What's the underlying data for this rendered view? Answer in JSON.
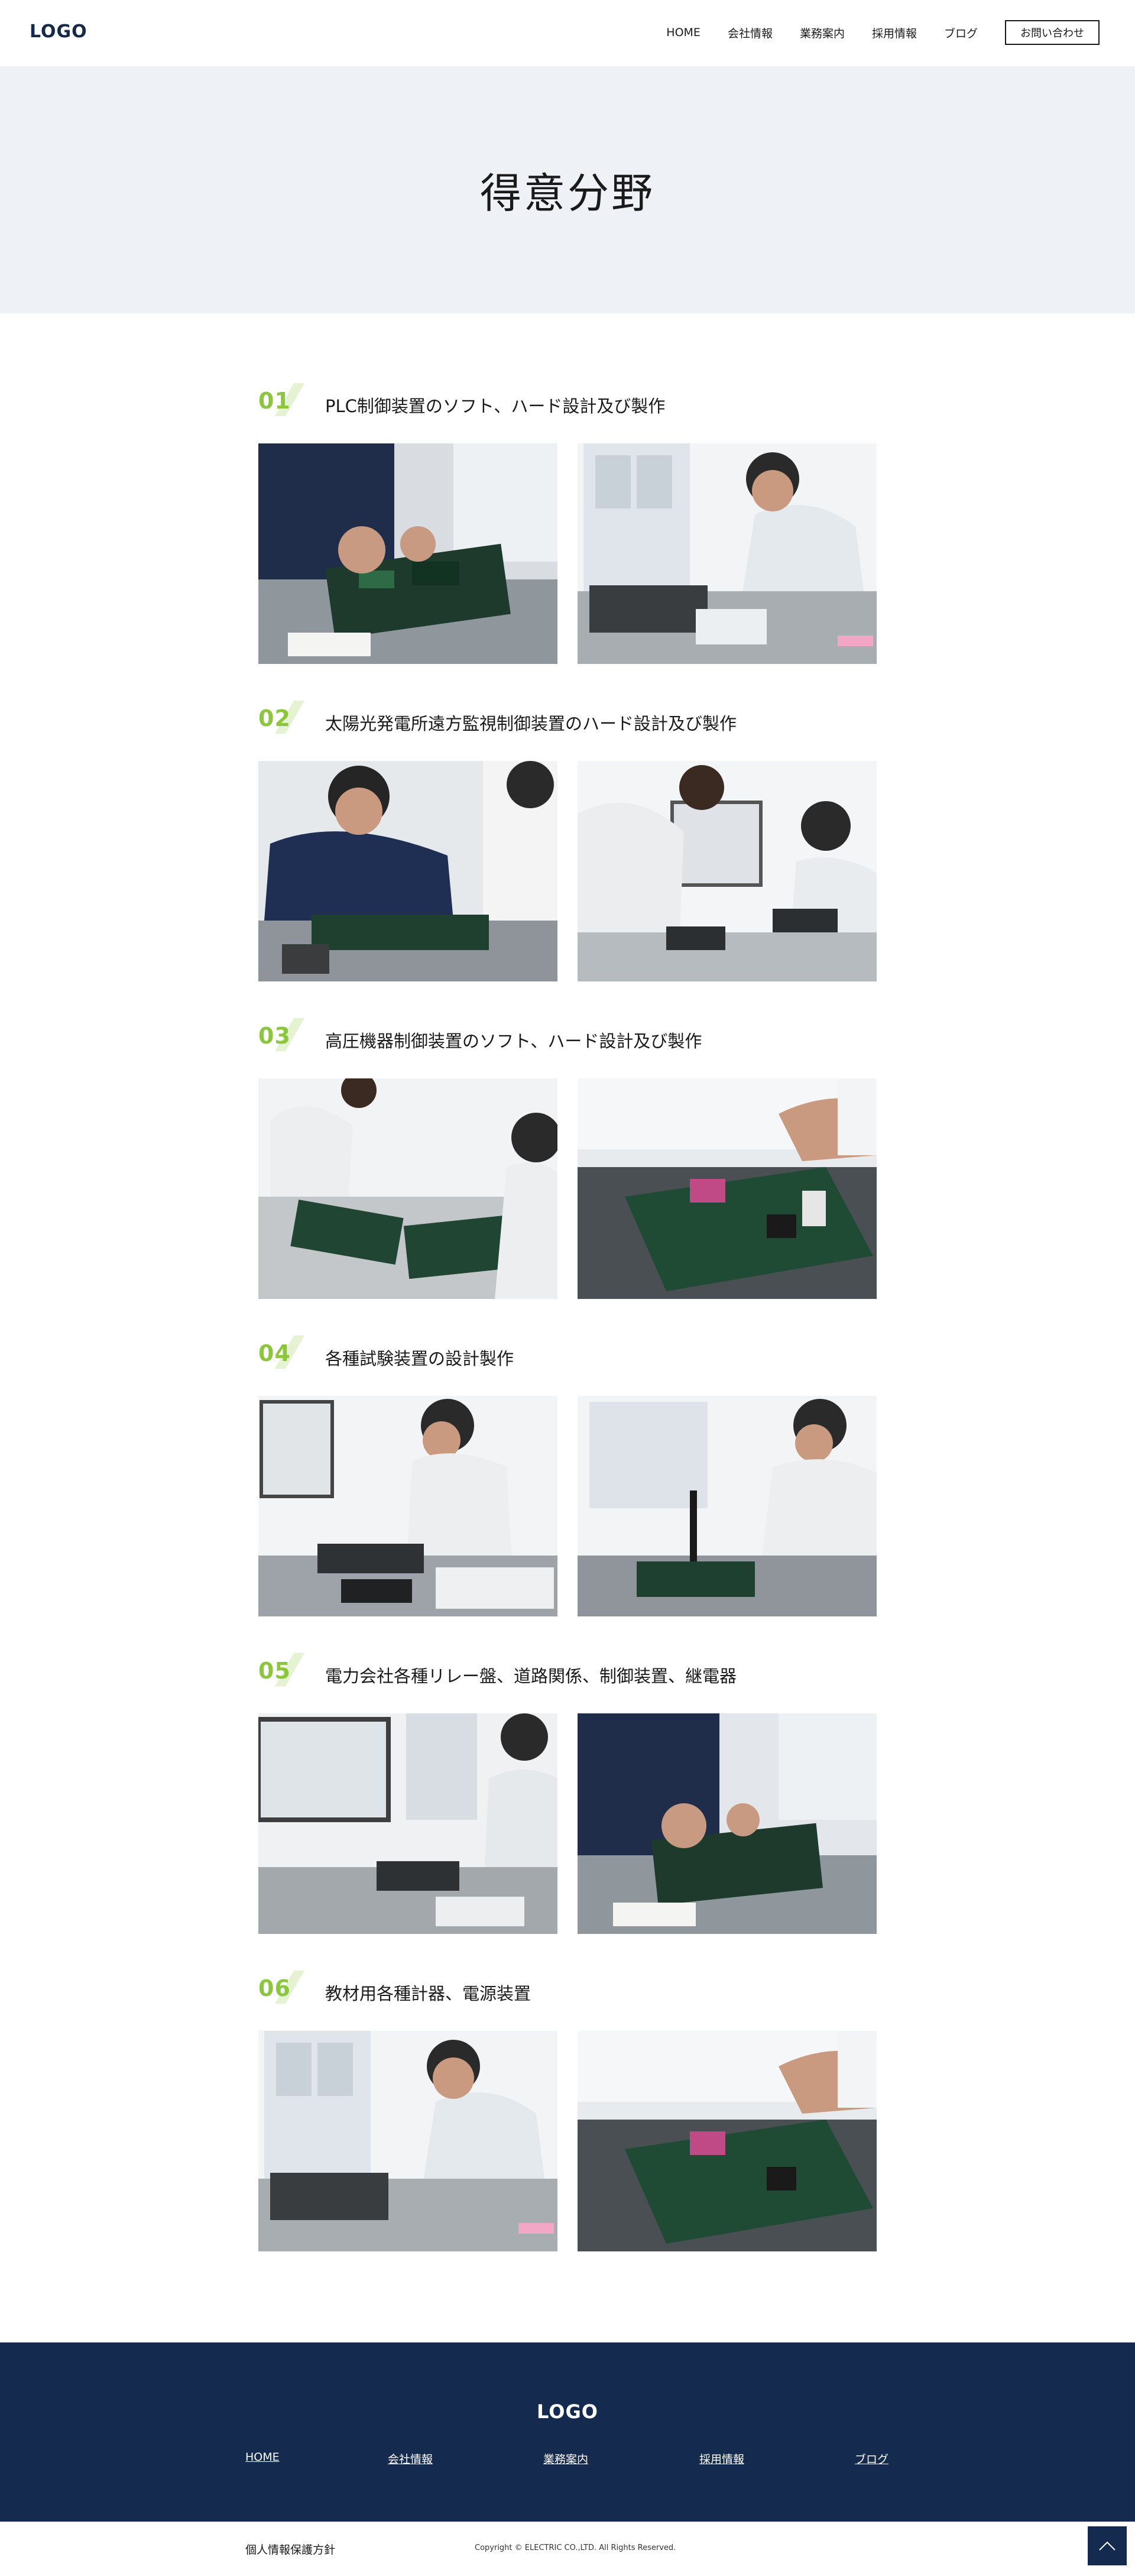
{
  "header": {
    "logo": "LOGO",
    "nav": [
      "HOME",
      "会社情報",
      "業務案内",
      "採用情報",
      "ブログ"
    ],
    "contact_label": "お問い合わせ"
  },
  "hero": {
    "title": "得意分野"
  },
  "sections": [
    {
      "num": "01",
      "title": "PLC制御装置のソフト、ハード設計及び製作"
    },
    {
      "num": "02",
      "title": "太陽光発電所遠方監視制御装置のハード設計及び製作"
    },
    {
      "num": "03",
      "title": "高圧機器制御装置のソフト、ハード設計及び製作"
    },
    {
      "num": "04",
      "title": "各種試験装置の設計製作"
    },
    {
      "num": "05",
      "title": "電力会社各種リレー盤、道路関係、制御装置、継電器"
    },
    {
      "num": "06",
      "title": "教材用各種計器、電源装置"
    }
  ],
  "footer": {
    "logo": "LOGO",
    "nav": [
      "HOME",
      "会社情報",
      "業務案内",
      "採用情報",
      "ブログ"
    ],
    "privacy": "個人情報保護方針",
    "copyright": "Copyright © ELECTRIC CO.,LTD. All Rights Reserved."
  },
  "icons": {
    "back_to_top": "chevron-up-icon"
  },
  "colors": {
    "accent": "#8cc63f",
    "navy": "#142a4e",
    "hero_bg": "#eef2f7"
  }
}
